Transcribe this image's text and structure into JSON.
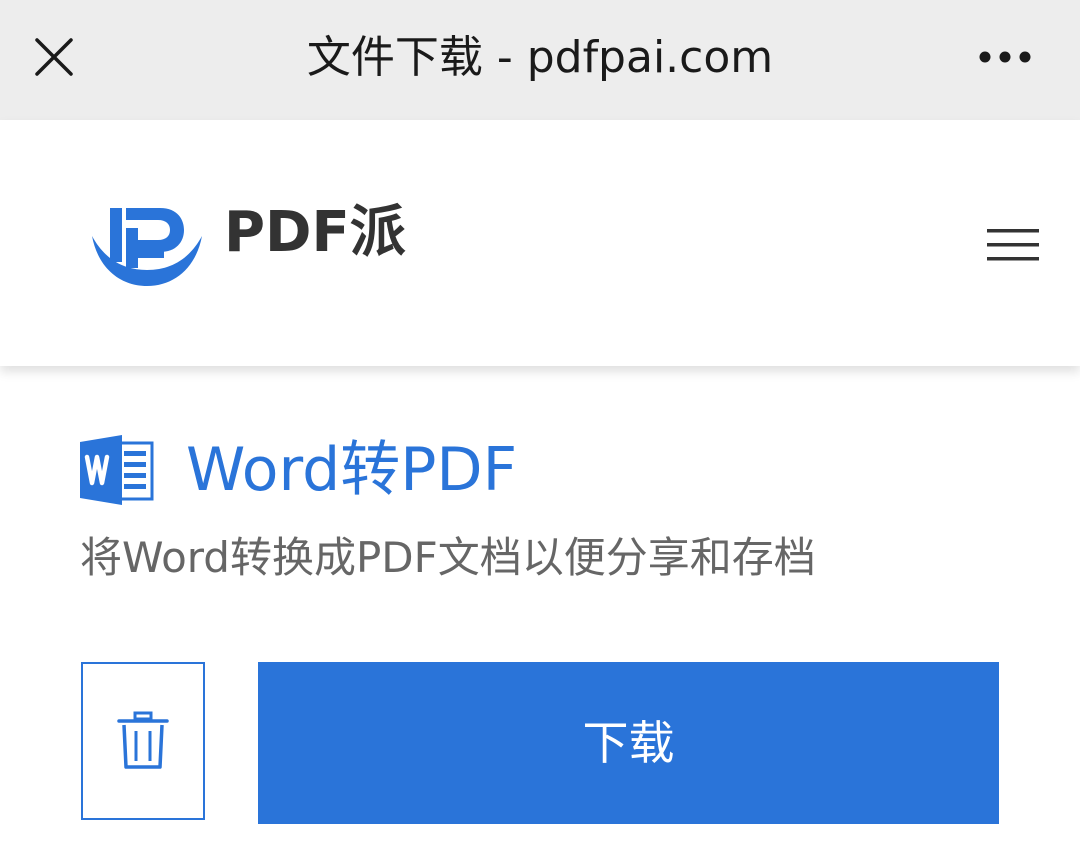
{
  "topbar": {
    "title": "文件下载 - pdfpai.com",
    "close_icon": "close-icon",
    "more_icon": "more-horizontal-icon"
  },
  "header": {
    "brand": "PDF派",
    "logo_icon": "pdfpai-logo",
    "menu_icon": "hamburger-menu-icon"
  },
  "tool": {
    "title": "Word转PDF",
    "description": "将Word转换成PDF文档以便分享和存档",
    "icon": "word-icon"
  },
  "actions": {
    "delete_icon": "trash-icon",
    "download_label": "下载"
  },
  "colors": {
    "accent": "#2a74d9",
    "topbar_bg": "#ededed",
    "title_text": "#1a1a1a",
    "desc_text": "#666666"
  }
}
